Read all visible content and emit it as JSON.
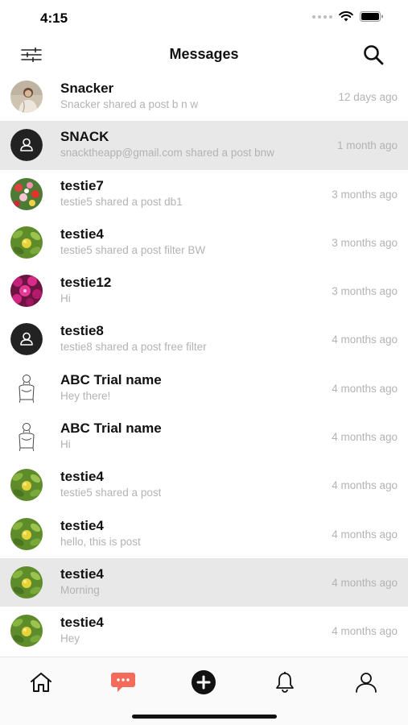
{
  "status_bar": {
    "time": "4:15"
  },
  "header": {
    "title": "Messages",
    "filter_icon": "sliders-icon",
    "search_icon": "search-icon"
  },
  "messages": [
    {
      "name": "Snacker",
      "preview": "Snacker shared a post b n w",
      "time": "12 days ago",
      "avatar": "photo-portrait",
      "highlight": false
    },
    {
      "name": "SNACK",
      "preview": "snacktheapp@gmail.com shared a post bnw",
      "time": "1 month ago",
      "avatar": "default-user",
      "highlight": true
    },
    {
      "name": "testie7",
      "preview": "testie5 shared a post db1",
      "time": "3 months ago",
      "avatar": "photo-flowers-red",
      "highlight": false
    },
    {
      "name": "testie4",
      "preview": "testie5 shared a post filter BW",
      "time": "3 months ago",
      "avatar": "photo-plant-yellow",
      "highlight": false
    },
    {
      "name": "testie12",
      "preview": "Hi",
      "time": "3 months ago",
      "avatar": "photo-flowers-magenta",
      "highlight": false
    },
    {
      "name": "testie8",
      "preview": "testie8 shared a post free filter",
      "time": "4 months ago",
      "avatar": "default-user",
      "highlight": false
    },
    {
      "name": "ABC Trial name",
      "preview": "Hey there!",
      "time": "4 months ago",
      "avatar": "sketch-person",
      "highlight": false
    },
    {
      "name": "ABC Trial name",
      "preview": "Hi",
      "time": "4 months ago",
      "avatar": "sketch-person",
      "highlight": false
    },
    {
      "name": "testie4",
      "preview": "testie5 shared a post",
      "time": "4 months ago",
      "avatar": "photo-plant-yellow",
      "highlight": false
    },
    {
      "name": "testie4",
      "preview": "hello, this is post",
      "time": "4 months ago",
      "avatar": "photo-plant-yellow",
      "highlight": false
    },
    {
      "name": "testie4",
      "preview": "Morning",
      "time": "4 months ago",
      "avatar": "photo-plant-yellow",
      "highlight": true
    },
    {
      "name": "testie4",
      "preview": "Hey",
      "time": "4 months ago",
      "avatar": "photo-plant-yellow",
      "highlight": false
    }
  ],
  "tab_bar": {
    "active": "messages",
    "accent_color": "#f26b5b",
    "tabs": [
      {
        "id": "home",
        "icon": "home-icon"
      },
      {
        "id": "messages",
        "icon": "chat-bubble-icon"
      },
      {
        "id": "create",
        "icon": "plus-circle-icon"
      },
      {
        "id": "notifications",
        "icon": "bell-icon"
      },
      {
        "id": "profile",
        "icon": "user-icon"
      }
    ]
  },
  "colors": {
    "highlight_row": "#e8e8e8",
    "secondary_text": "#b3b3b3",
    "default_avatar": "#222222"
  }
}
